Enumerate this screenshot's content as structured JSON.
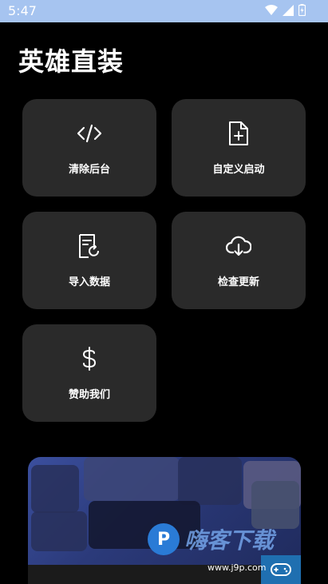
{
  "status_bar": {
    "time": "5:47",
    "icons": [
      "wifi-icon",
      "signal-icon",
      "battery-icon"
    ],
    "color": "#a6c4f0"
  },
  "header": {
    "title": "英雄直装"
  },
  "cards": [
    {
      "label": "清除后台",
      "icon": "code-icon"
    },
    {
      "label": "自定义启动",
      "icon": "file-plus-icon"
    },
    {
      "label": "导入数据",
      "icon": "file-sync-icon"
    },
    {
      "label": "检查更新",
      "icon": "cloud-download-icon"
    },
    {
      "label": "赞助我们",
      "icon": "dollar-icon"
    }
  ],
  "banner": {
    "watermark_text": "嗨客下载",
    "watermark_url": "www.j9p.com",
    "watermark_logo": "P"
  },
  "colors": {
    "background": "#000000",
    "card": "#2a2a2a",
    "text": "#ffffff"
  }
}
